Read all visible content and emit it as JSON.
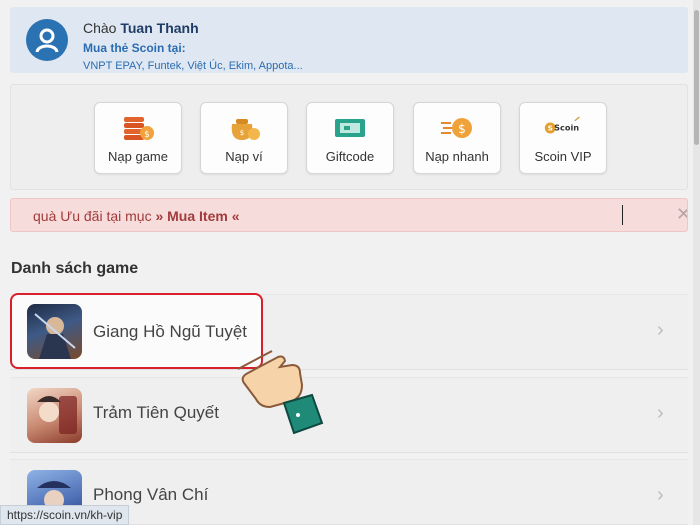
{
  "header": {
    "greeting_prefix": "Chào",
    "user_name": "Tuan Thanh",
    "buy_title": "Mua thẻ Scoin tại:",
    "partners": "VNPT EPAY, Funtek, Việt Úc, Ekim, Appota..."
  },
  "actions": [
    {
      "label": "Nạp game",
      "icon": "coin-stack-icon"
    },
    {
      "label": "Nạp ví",
      "icon": "money-bag-icon"
    },
    {
      "label": "Giftcode",
      "icon": "ticket-icon"
    },
    {
      "label": "Nạp nhanh",
      "icon": "fast-coin-icon"
    },
    {
      "label": "Scoin VIP",
      "icon": "scoin-logo-icon"
    }
  ],
  "scoin_logo_text": "Scoin",
  "notice": {
    "prefix": "quà Ưu đãi tại mục",
    "link": "» Mua Item «"
  },
  "game_list": {
    "title": "Danh sách game",
    "games": [
      {
        "name": "Giang Hồ Ngũ Tuyệt"
      },
      {
        "name": "Trảm Tiên Quyết"
      },
      {
        "name": "Phong Vân Chí"
      }
    ]
  },
  "status_url": "https://scoin.vn/kh-vip",
  "colors": {
    "accent_blue": "#2b72b2",
    "highlight_red": "#d8202a",
    "notice_bg": "#f7dcdc"
  }
}
